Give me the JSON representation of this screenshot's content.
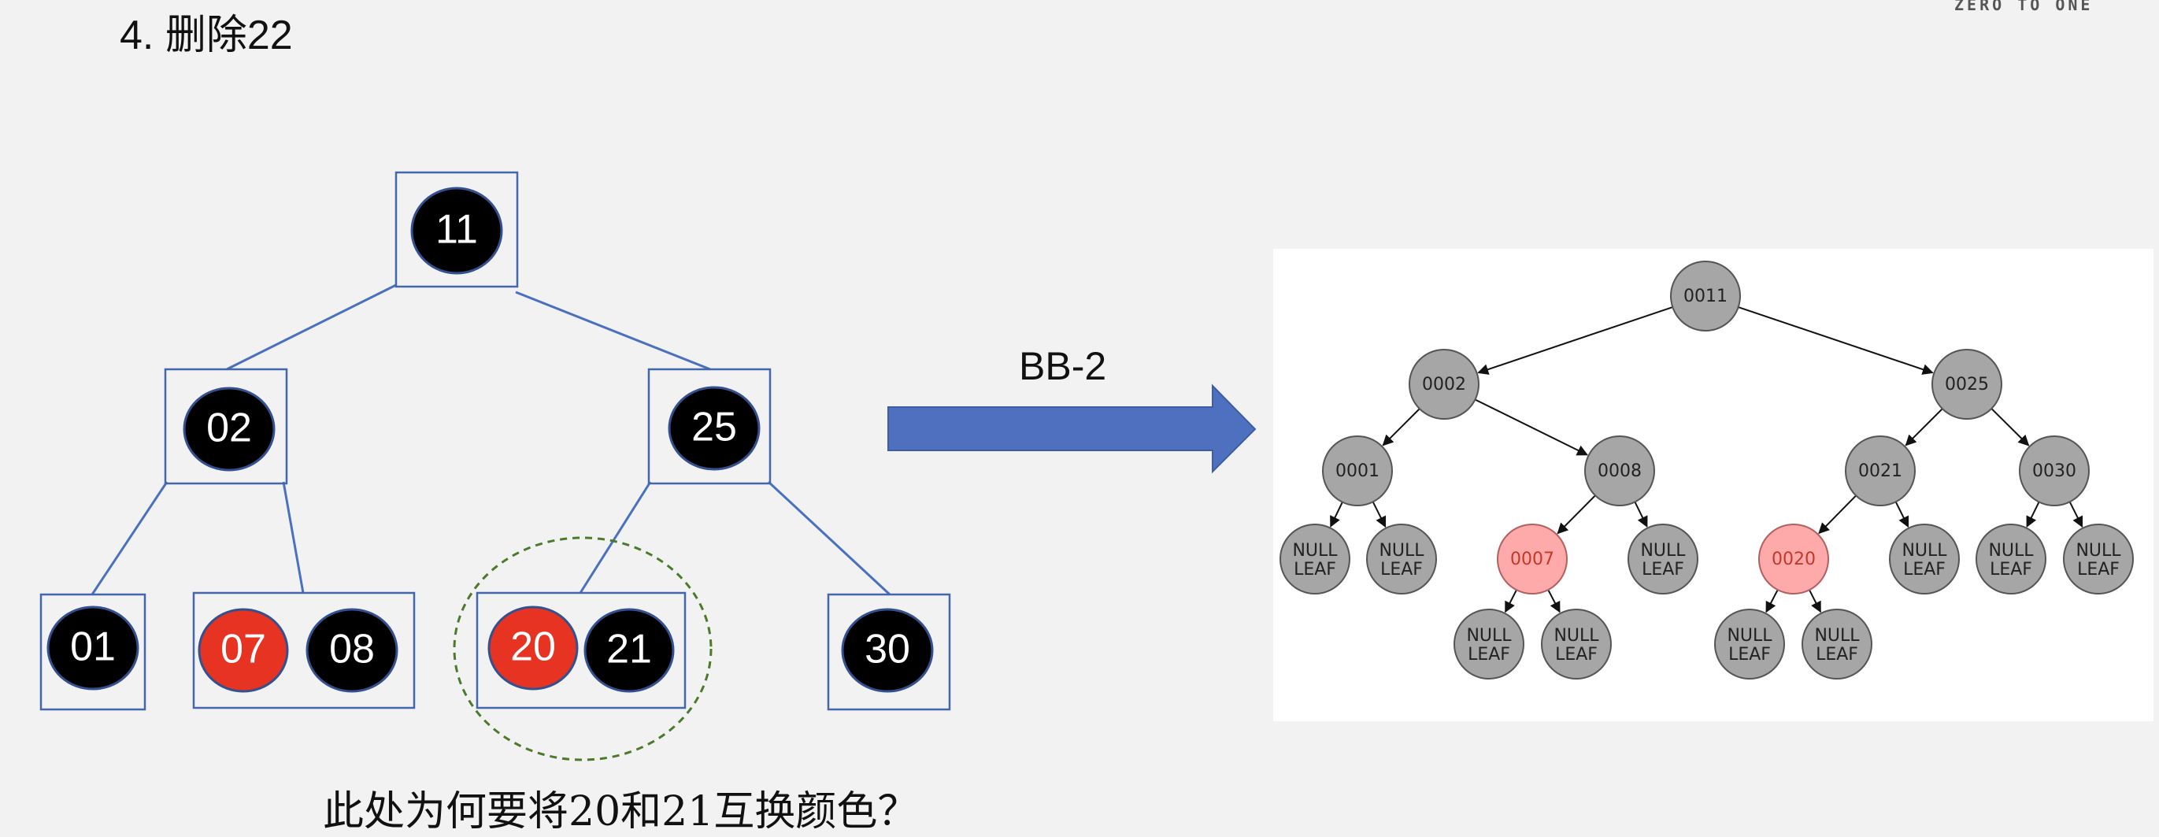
{
  "slide": {
    "title": "4. 删除22",
    "brand": "ZERO TO ONE",
    "question": "此处为何要将20和21互换颜色？",
    "arrow_label": "BB-2"
  },
  "colors": {
    "background": "#f2f2f2",
    "box_border": "#4466aa",
    "edge": "#4a70c0",
    "black_key": "#000000",
    "red_key": "#e63322",
    "arrow_fill": "#4f6fbf",
    "highlight_circle": "#4a7a2a",
    "tree_node_gray": "#a6a6a6",
    "tree_node_red": "#ffaaaa",
    "tree_red_text": "#c0392b"
  },
  "btree": {
    "nodes": [
      {
        "id": "n11",
        "keys": [
          {
            "label": "11",
            "color": "black"
          }
        ]
      },
      {
        "id": "n02",
        "keys": [
          {
            "label": "02",
            "color": "black"
          }
        ]
      },
      {
        "id": "n25",
        "keys": [
          {
            "label": "25",
            "color": "black"
          }
        ]
      },
      {
        "id": "n01",
        "keys": [
          {
            "label": "01",
            "color": "black"
          }
        ]
      },
      {
        "id": "n0708",
        "keys": [
          {
            "label": "07",
            "color": "red"
          },
          {
            "label": "08",
            "color": "black"
          }
        ]
      },
      {
        "id": "n2021",
        "keys": [
          {
            "label": "20",
            "color": "red"
          },
          {
            "label": "21",
            "color": "black"
          }
        ]
      },
      {
        "id": "n30",
        "keys": [
          {
            "label": "30",
            "color": "black"
          }
        ]
      }
    ],
    "edges": [
      [
        "n11",
        "n02"
      ],
      [
        "n11",
        "n25"
      ],
      [
        "n02",
        "n01"
      ],
      [
        "n02",
        "n0708"
      ],
      [
        "n25",
        "n2021"
      ],
      [
        "n25",
        "n30"
      ]
    ],
    "highlighted": "n2021"
  },
  "rbtree": {
    "nodes": [
      {
        "id": "t0011",
        "label": "0011",
        "color": "gray"
      },
      {
        "id": "t0002",
        "label": "0002",
        "color": "gray"
      },
      {
        "id": "t0025",
        "label": "0025",
        "color": "gray"
      },
      {
        "id": "t0001",
        "label": "0001",
        "color": "gray"
      },
      {
        "id": "t0008",
        "label": "0008",
        "color": "gray"
      },
      {
        "id": "t0021",
        "label": "0021",
        "color": "gray"
      },
      {
        "id": "t0030",
        "label": "0030",
        "color": "gray"
      },
      {
        "id": "l1",
        "label": "NULL LEAF",
        "color": "gray"
      },
      {
        "id": "l2",
        "label": "NULL LEAF",
        "color": "gray"
      },
      {
        "id": "t0007",
        "label": "0007",
        "color": "red"
      },
      {
        "id": "l3",
        "label": "NULL LEAF",
        "color": "gray"
      },
      {
        "id": "t0020",
        "label": "0020",
        "color": "red"
      },
      {
        "id": "l4",
        "label": "NULL LEAF",
        "color": "gray"
      },
      {
        "id": "l5",
        "label": "NULL LEAF",
        "color": "gray"
      },
      {
        "id": "l6",
        "label": "NULL LEAF",
        "color": "gray"
      },
      {
        "id": "l7",
        "label": "NULL LEAF",
        "color": "gray"
      },
      {
        "id": "l8",
        "label": "NULL LEAF",
        "color": "gray"
      },
      {
        "id": "l9",
        "label": "NULL LEAF",
        "color": "gray"
      },
      {
        "id": "l10",
        "label": "NULL LEAF",
        "color": "gray"
      }
    ],
    "edges": [
      [
        "t0011",
        "t0002"
      ],
      [
        "t0011",
        "t0025"
      ],
      [
        "t0002",
        "t0001"
      ],
      [
        "t0002",
        "t0008"
      ],
      [
        "t0025",
        "t0021"
      ],
      [
        "t0025",
        "t0030"
      ],
      [
        "t0001",
        "l1"
      ],
      [
        "t0001",
        "l2"
      ],
      [
        "t0008",
        "t0007"
      ],
      [
        "t0008",
        "l3"
      ],
      [
        "t0021",
        "t0020"
      ],
      [
        "t0021",
        "l4"
      ],
      [
        "t0030",
        "l5"
      ],
      [
        "t0030",
        "l6"
      ],
      [
        "t0007",
        "l7"
      ],
      [
        "t0007",
        "l8"
      ],
      [
        "t0020",
        "l9"
      ],
      [
        "t0020",
        "l10"
      ]
    ]
  }
}
